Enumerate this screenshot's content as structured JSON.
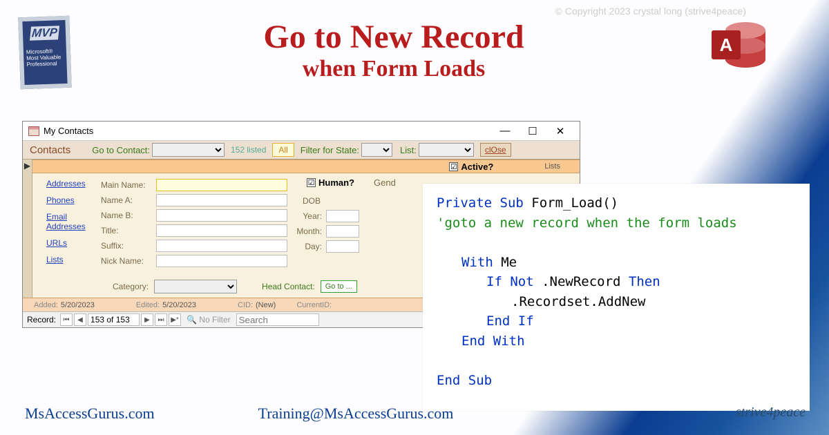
{
  "copyright": "© Copyright 2023 crystal long (strive4peace)",
  "mvp": {
    "big": "MVP",
    "sub": "Microsoft® Most Valuable Professional"
  },
  "title": {
    "line1": "Go to New Record",
    "line2": "when Form Loads"
  },
  "access_letter": "A",
  "window": {
    "title": "My Contacts",
    "min": "—",
    "max": "☐",
    "close": "✕",
    "toolbar": {
      "contacts": "Contacts",
      "goto_label": "Go to Contact:",
      "count": "152 listed",
      "all": "All",
      "filter_state": "Filter for State:",
      "list": "List:",
      "close": "clOse"
    },
    "active_chk": "☑",
    "active_lbl": "Active?",
    "lists_lbl": "Lists",
    "links": [
      "Addresses",
      "Phones",
      "Email Addresses",
      "URLs",
      "Lists"
    ],
    "fields": {
      "main": "Main Name:",
      "a": "Name A:",
      "b": "Name B:",
      "title": "Title:",
      "suffix": "Suffix:",
      "nick": "Nick Name:"
    },
    "human_chk": "☑",
    "human_lbl": "Human?",
    "gend_lbl": "Gend",
    "dob": {
      "group": "DOB",
      "year": "Year:",
      "month": "Month:",
      "day": "Day:"
    },
    "category": "Category:",
    "head_contact": "Head Contact:",
    "goto_btn": "Go to ...",
    "added_lbl": "Added:",
    "added_val": "5/20/2023",
    "edited_lbl": "Edited:",
    "edited_val": "5/20/2023",
    "cid_lbl": "CID:",
    "cid_val": "(New)",
    "curid_lbl": "CurrentID:",
    "nav": {
      "record": "Record:",
      "first": "⏮",
      "prev": "◀",
      "pos": "153 of 153",
      "next": "▶",
      "last": "⏭",
      "new": "▶*",
      "nofilter": "🔍 No Filter",
      "search": "Search"
    }
  },
  "code": {
    "l1a": "Private Sub",
    "l1b": " Form_Load()",
    "l2": "'goto a new record when the form loads",
    "l3a": "With",
    "l3b": " Me",
    "l4a": "If Not",
    "l4b": " .NewRecord ",
    "l4c": "Then",
    "l5": ".Recordset.AddNew",
    "l6": "End If",
    "l7": "End With",
    "l8": "End Sub"
  },
  "footer": {
    "site": "MsAccessGurus.com",
    "email": "Training@MsAccessGurus.com",
    "tag": "strive4peace"
  }
}
